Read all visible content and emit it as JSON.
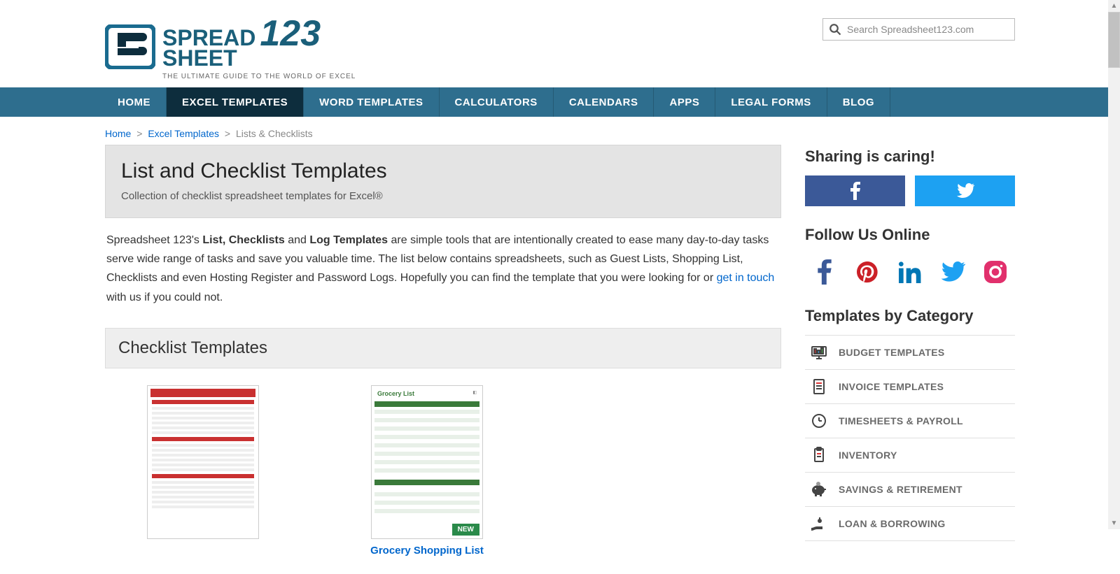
{
  "logo": {
    "line1a": "SPREAD",
    "line1b": "123",
    "line2": "SHEET",
    "tagline": "THE ULTIMATE GUIDE TO THE WORLD OF EXCEL"
  },
  "search": {
    "placeholder": "Search Spreadsheet123.com"
  },
  "nav": {
    "items": [
      "HOME",
      "EXCEL TEMPLATES",
      "WORD TEMPLATES",
      "CALCULATORS",
      "CALENDARS",
      "APPS",
      "LEGAL FORMS",
      "BLOG"
    ],
    "activeIndex": 1
  },
  "breadcrumb": {
    "home": "Home",
    "mid": "Excel Templates",
    "current": "Lists & Checklists"
  },
  "hero": {
    "title": "List and Checklist Templates",
    "subtitle": "Collection of checklist spreadsheet templates for Excel®"
  },
  "intro": {
    "pre": "Spreadsheet 123's ",
    "b1": "List, Checklists",
    "mid1": " and ",
    "b2": "Log Templates",
    "rest": " are simple tools that are intentionally created to ease many day-to-day tasks serve wide range of tasks and save you valuable time. The list below contains spreadsheets, such as Guest Lists, Shopping List, Checklists and even Hosting Register and Password Logs. Hopefully you can find the template that you were looking for or ",
    "link": "get in touch",
    "tail": " with us if you could not."
  },
  "section1": {
    "title": "Checklist Templates"
  },
  "templates": [
    {
      "title": "",
      "new": false,
      "theme": "red"
    },
    {
      "title": "Grocery Shopping List",
      "new": true,
      "theme": "green"
    }
  ],
  "sidebar": {
    "sharing_title": "Sharing is caring!",
    "follow_title": "Follow Us Online",
    "categories_title": "Templates by Category",
    "categories": [
      {
        "label": "BUDGET TEMPLATES",
        "icon": "monitor"
      },
      {
        "label": "INVOICE TEMPLATES",
        "icon": "invoice"
      },
      {
        "label": "TIMESHEETS & PAYROLL",
        "icon": "clock"
      },
      {
        "label": "INVENTORY",
        "icon": "clipboard"
      },
      {
        "label": "SAVINGS & RETIREMENT",
        "icon": "piggy"
      },
      {
        "label": "LOAN & BORROWING",
        "icon": "hand"
      }
    ]
  }
}
